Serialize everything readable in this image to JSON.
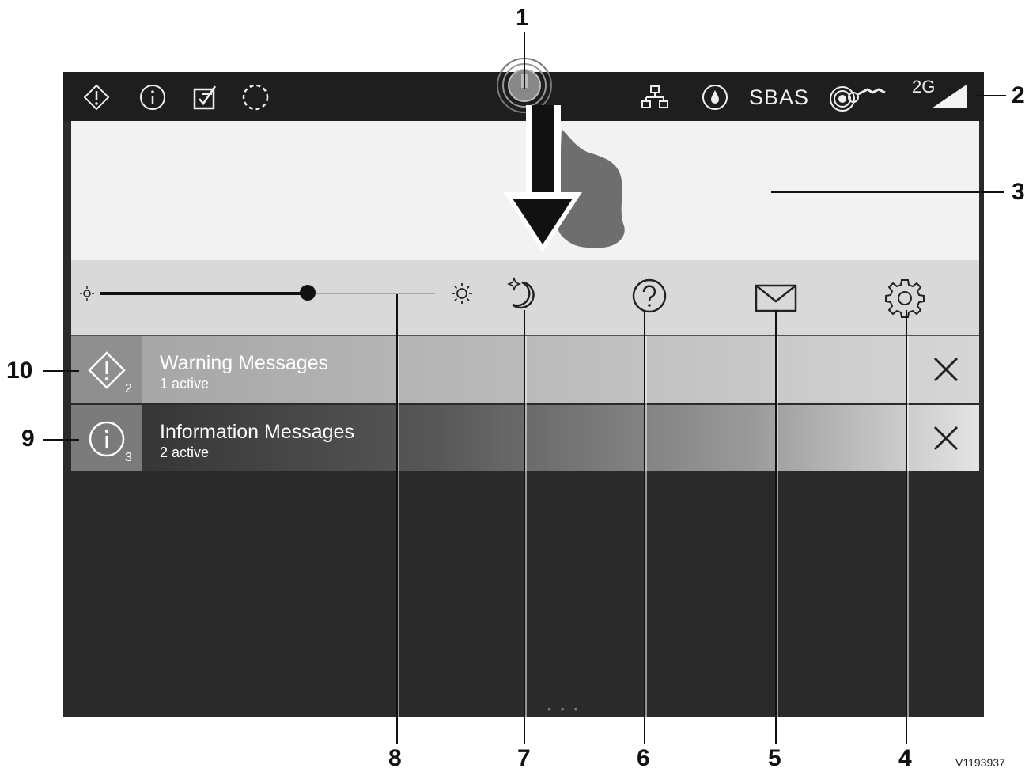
{
  "status_bar": {
    "icons": [
      "warning-icon",
      "info-icon",
      "task-check-icon",
      "loading-circle-icon",
      "touch-target-icon",
      "network-icon",
      "drop-icon",
      "radio-wave-icon",
      "signal-strength-icon"
    ],
    "sbas_label": "SBAS",
    "network_label": "2G"
  },
  "quick_settings": {
    "brightness_level_percent": 62,
    "icons": [
      "brightness-low-icon",
      "brightness-high-icon",
      "night-mode-icon",
      "help-icon",
      "mail-icon",
      "settings-gear-icon"
    ]
  },
  "messages": [
    {
      "title": "Warning Messages",
      "subtitle": "1 active",
      "count": "2",
      "icon": "warning-icon"
    },
    {
      "title": "Information Messages",
      "subtitle": "2 active",
      "count": "3",
      "icon": "info-icon"
    }
  ],
  "callouts": [
    "1",
    "2",
    "3",
    "4",
    "5",
    "6",
    "7",
    "8",
    "9",
    "10"
  ],
  "figure_code": "V1193937",
  "colors": {
    "status_bar": "#1e1e1e",
    "drawer": "#f2f2f2",
    "quickbar": "#d9d9d9",
    "screen": "#2a2a2a"
  }
}
